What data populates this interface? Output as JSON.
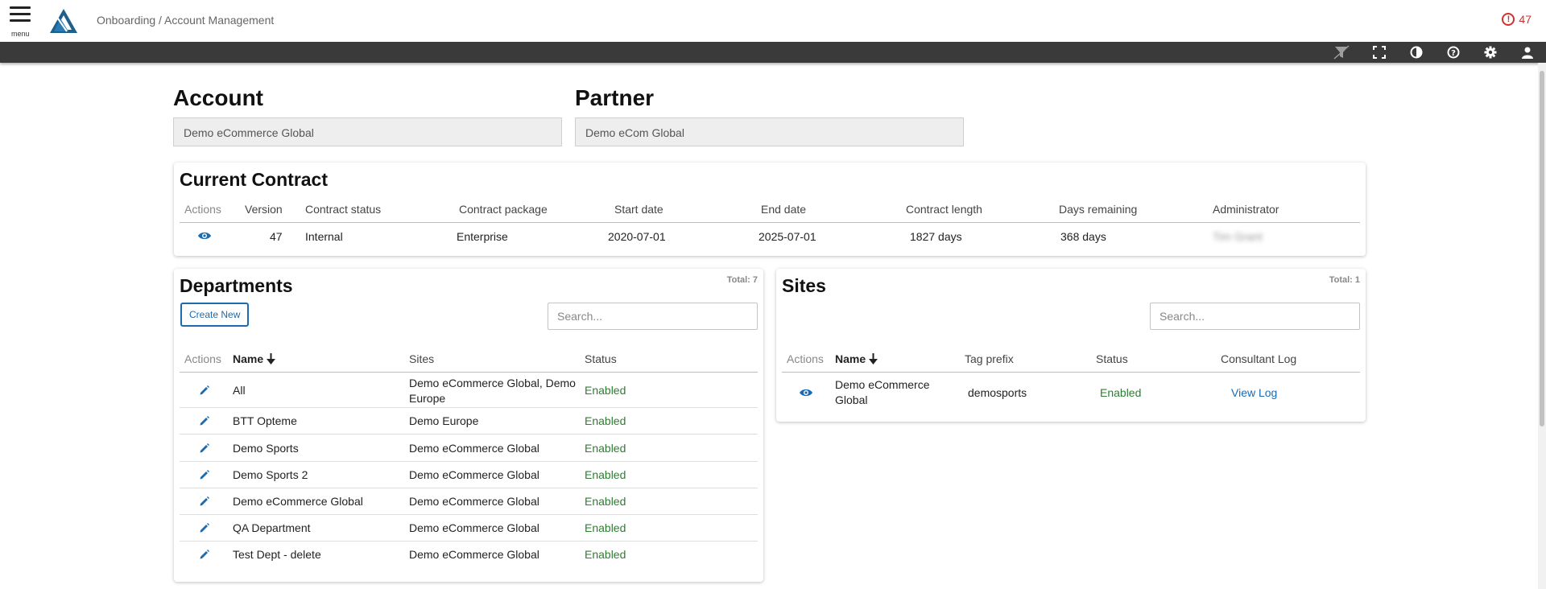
{
  "header": {
    "menu_label": "menu",
    "breadcrumb": "Onboarding / Account Management",
    "alert_count": "47"
  },
  "toolbar": {
    "icons": [
      "filter-icon",
      "fullscreen-icon",
      "contrast-icon",
      "help-icon",
      "settings-icon",
      "user-icon"
    ]
  },
  "account": {
    "title": "Account",
    "value": "Demo eCommerce Global"
  },
  "partner": {
    "title": "Partner",
    "value": "Demo eCom Global"
  },
  "contract": {
    "title": "Current Contract",
    "headers": {
      "actions": "Actions",
      "version": "Version",
      "status": "Contract status",
      "package": "Contract package",
      "start": "Start date",
      "end": "End date",
      "length": "Contract length",
      "remaining": "Days remaining",
      "admin": "Administrator"
    },
    "row": {
      "version": "47",
      "status": "Internal",
      "package": "Enterprise",
      "start": "2020-07-01",
      "end": "2025-07-01",
      "length": "1827 days",
      "remaining": "368 days",
      "admin": "Tim Grant"
    }
  },
  "departments": {
    "title": "Departments",
    "total": "Total: 7",
    "create_label": "Create New",
    "search_placeholder": "Search...",
    "headers": {
      "actions": "Actions",
      "name": "Name",
      "sites": "Sites",
      "status": "Status"
    },
    "rows": [
      {
        "name": "All",
        "sites": "Demo eCommerce Global, Demo Europe",
        "status": "Enabled"
      },
      {
        "name": "BTT Opteme",
        "sites": "Demo Europe",
        "status": "Enabled"
      },
      {
        "name": "Demo Sports",
        "sites": "Demo eCommerce Global",
        "status": "Enabled"
      },
      {
        "name": "Demo Sports 2",
        "sites": "Demo eCommerce Global",
        "status": "Enabled"
      },
      {
        "name": "Demo eCommerce Global",
        "sites": "Demo eCommerce Global",
        "status": "Enabled"
      },
      {
        "name": "QA Department",
        "sites": "Demo eCommerce Global",
        "status": "Enabled"
      },
      {
        "name": "Test Dept - delete",
        "sites": "Demo eCommerce Global",
        "status": "Enabled"
      }
    ]
  },
  "sites": {
    "title": "Sites",
    "total": "Total: 1",
    "search_placeholder": "Search...",
    "headers": {
      "actions": "Actions",
      "name": "Name",
      "tag_prefix": "Tag prefix",
      "status": "Status",
      "consultant_log": "Consultant Log"
    },
    "rows": [
      {
        "name": "Demo eCommerce Global",
        "tag_prefix": "demosports",
        "status": "Enabled",
        "log_link": "View Log"
      }
    ]
  },
  "colors": {
    "accent": "#1a6bb0",
    "enabled": "#2e7d32",
    "alert": "#d32f2f",
    "toolbar": "#3a3a3a"
  }
}
